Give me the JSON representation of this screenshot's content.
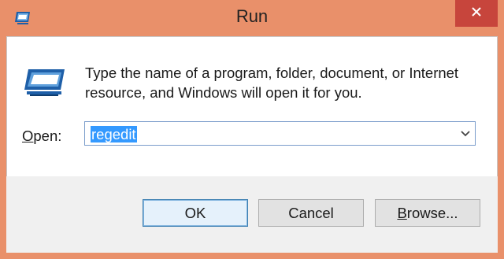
{
  "window": {
    "title": "Run"
  },
  "dialog": {
    "description": "Type the name of a program, folder, document, or Internet resource, and Windows will open it for you.",
    "open_label_accesskey": "O",
    "open_label_rest": "pen:",
    "open_value": "regedit"
  },
  "buttons": {
    "ok": "OK",
    "cancel": "Cancel",
    "browse_accesskey": "B",
    "browse_rest": "rowse..."
  },
  "icons": {
    "title": "run-icon",
    "dialog": "run-icon",
    "close": "close-icon",
    "dropdown": "chevron-down-icon"
  },
  "colors": {
    "frame": "#E9906A",
    "close_button": "#C7453C",
    "selection": "#3399FF",
    "footer": "#F0F0F0"
  }
}
